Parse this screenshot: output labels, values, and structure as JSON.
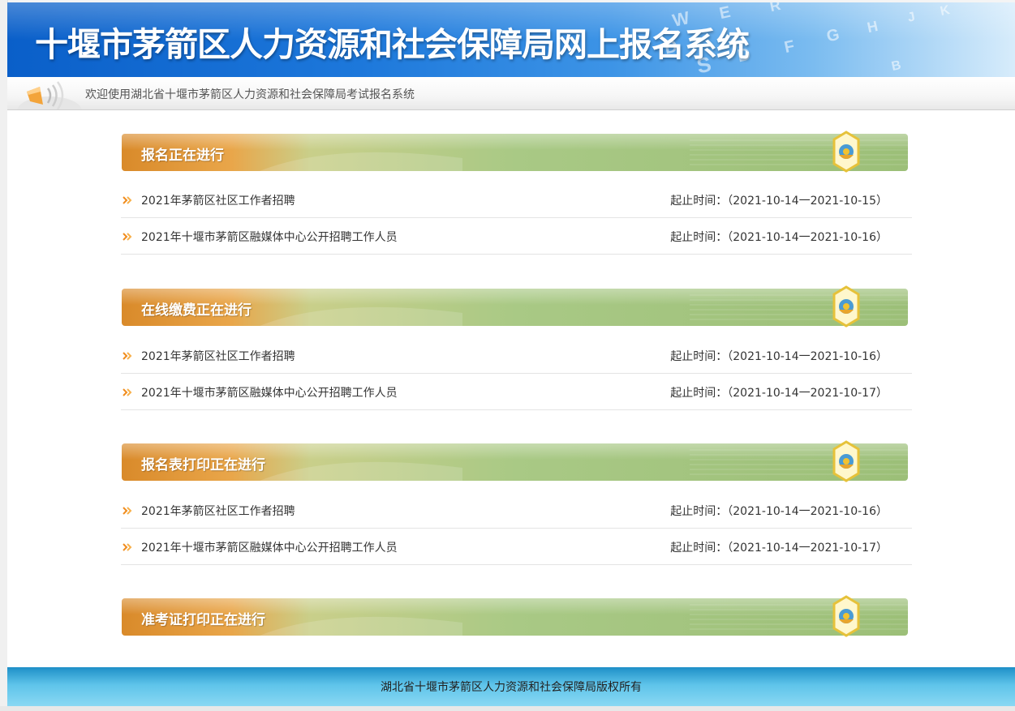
{
  "banner": {
    "title": "十堰市茅箭区人力资源和社会保障局网上报名系统"
  },
  "welcome": {
    "text": "欢迎使用湖北省十堰市茅箭区人力资源和社会保障局考试报名系统"
  },
  "sections": [
    {
      "title": "报名正在进行",
      "items": [
        {
          "name": "2021年茅箭区社区工作者招聘",
          "time": "起止时间：（2021-10-14一2021-10-15）"
        },
        {
          "name": "2021年十堰市茅箭区融媒体中心公开招聘工作人员",
          "time": "起止时间：（2021-10-14一2021-10-16）"
        }
      ]
    },
    {
      "title": "在线缴费正在进行",
      "items": [
        {
          "name": "2021年茅箭区社区工作者招聘",
          "time": "起止时间：（2021-10-14一2021-10-16）"
        },
        {
          "name": "2021年十堰市茅箭区融媒体中心公开招聘工作人员",
          "time": "起止时间：（2021-10-14一2021-10-17）"
        }
      ]
    },
    {
      "title": "报名表打印正在进行",
      "items": [
        {
          "name": "2021年茅箭区社区工作者招聘",
          "time": "起止时间：（2021-10-14一2021-10-16）"
        },
        {
          "name": "2021年十堰市茅箭区融媒体中心公开招聘工作人员",
          "time": "起止时间：（2021-10-14一2021-10-17）"
        }
      ]
    },
    {
      "title": "准考证打印正在进行",
      "items": []
    }
  ],
  "footer": {
    "text": "湖北省十堰市茅箭区人力资源和社会保障局版权所有"
  },
  "colors": {
    "banner_blue": "#1d78db",
    "section_green": "#9dc07a",
    "section_orange": "#e8892c",
    "bullet_orange": "#f08c1e",
    "footer_blue": "#5ec4ea"
  },
  "icons": {
    "bullet": "double-chevron-right-icon",
    "section_badge": "hexagon-gear-icon",
    "speaker": "speaker-icon"
  }
}
